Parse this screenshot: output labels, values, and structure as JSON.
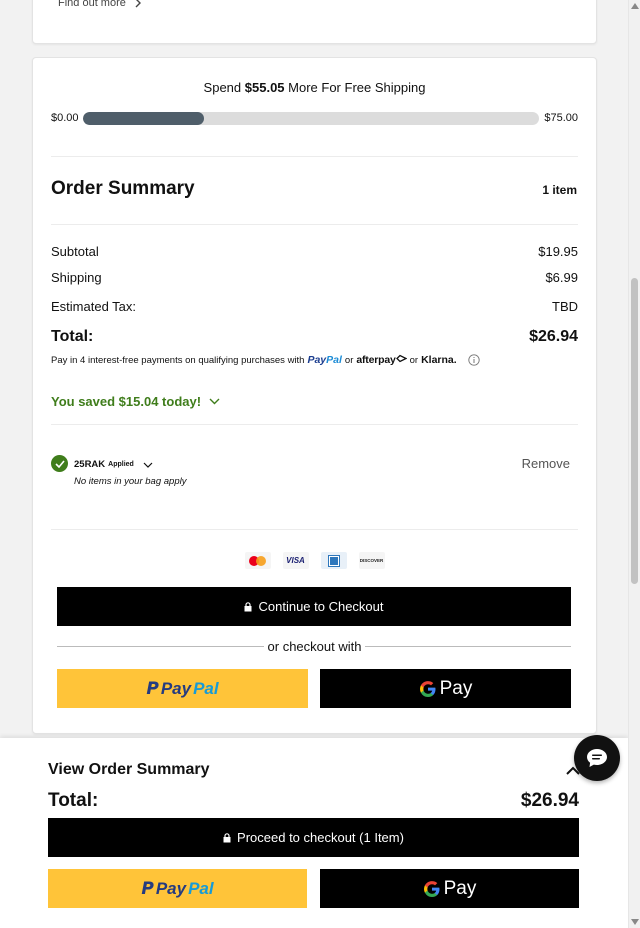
{
  "top_card": {
    "find_out_more": "Find out more"
  },
  "shipping": {
    "prefix": "Spend",
    "amount": "$55.05",
    "suffix": "More For Free Shipping",
    "min_label": "$0.00",
    "max_label": "$75.00",
    "progress_fraction": 0.266
  },
  "summary": {
    "title": "Order Summary",
    "item_count": "1 item",
    "subtotal_label": "Subtotal",
    "subtotal_value": "$19.95",
    "shipping_label": "Shipping",
    "shipping_value": "$6.99",
    "tax_label": "Estimated Tax:",
    "tax_value": "TBD",
    "total_label": "Total:",
    "total_value": "$26.94",
    "pay4_text": "Pay in 4 interest-free payments on qualifying purchases with",
    "or1": "or",
    "or2": "or",
    "paypal_a": "Pay",
    "paypal_b": "Pal",
    "afterpay": "afterpay",
    "klarna": "Klarna.",
    "saved_text": "You saved $15.04 today!"
  },
  "promo": {
    "code": "25RAK",
    "applied": "Applied",
    "note": "No items in your bag apply",
    "remove_label": "Remove"
  },
  "payment_cards": {
    "visa": "VISA",
    "discover": "DISCOVER"
  },
  "checkout": {
    "continue_label": "Continue to Checkout",
    "or_checkout_with": "or checkout with",
    "paypal_a": "Pay",
    "paypal_b": "Pal",
    "gpay_label": "Pay"
  },
  "sticky": {
    "view_title": "View Order Summary",
    "total_label": "Total:",
    "total_value": "$26.94",
    "proceed_label": "Proceed to checkout (1 Item)",
    "paypal_a": "Pay",
    "paypal_b": "Pal",
    "gpay_label": "Pay"
  },
  "colors": {
    "accent_green": "#3f7d1b",
    "paypal_yellow": "#ffc439",
    "progress_fill": "#4f5e6a"
  }
}
